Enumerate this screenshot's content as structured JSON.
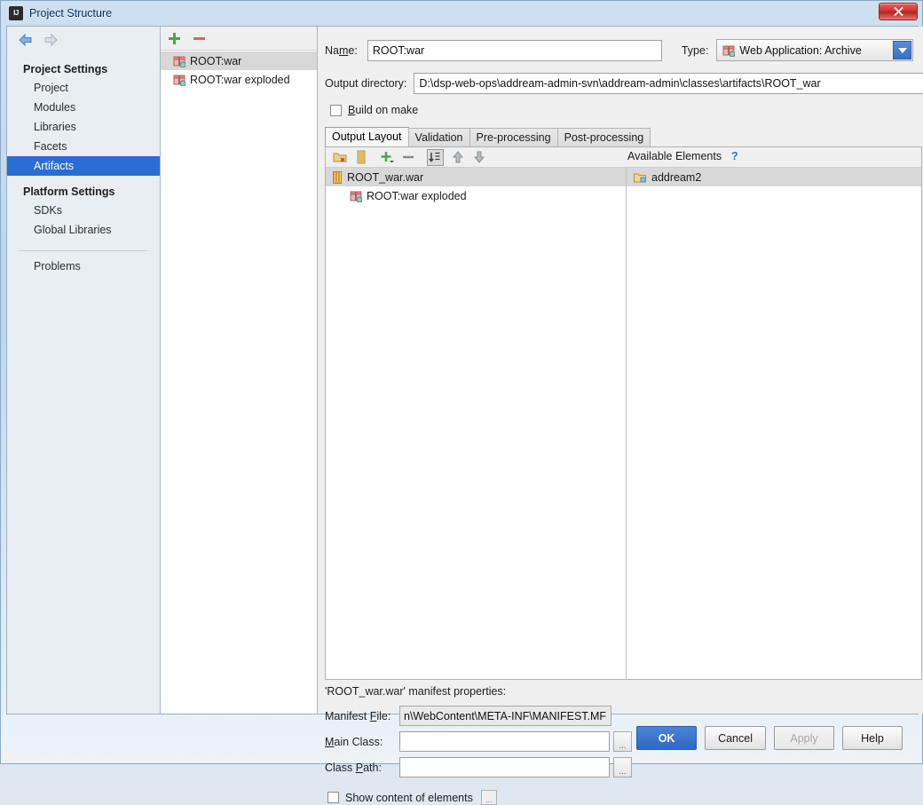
{
  "window": {
    "title": "Project Structure",
    "icon": "intellij-logo-icon",
    "close_label": "×"
  },
  "sidebar": {
    "back_icon": "arrow-left-icon",
    "forward_icon": "arrow-right-icon",
    "groups": [
      {
        "label": "Project Settings",
        "items": [
          {
            "label": "Project",
            "selected": false
          },
          {
            "label": "Modules",
            "selected": false
          },
          {
            "label": "Libraries",
            "selected": false
          },
          {
            "label": "Facets",
            "selected": false
          },
          {
            "label": "Artifacts",
            "selected": true
          }
        ]
      },
      {
        "label": "Platform Settings",
        "items": [
          {
            "label": "SDKs",
            "selected": false
          },
          {
            "label": "Global Libraries",
            "selected": false
          }
        ]
      }
    ],
    "problems_label": "Problems"
  },
  "artifact_list": {
    "add_label": "+",
    "remove_label": "−",
    "items": [
      {
        "label": "ROOT:war",
        "selected": true
      },
      {
        "label": "ROOT:war exploded",
        "selected": false
      }
    ]
  },
  "main": {
    "name_label": "Name:",
    "name_value": "ROOT:war",
    "name_placeholder": "",
    "type_label": "Type:",
    "type_value": "Web Application: Archive",
    "output_dir_label": "Output directory:",
    "output_dir_value": "D:\\dsp-web-ops\\addream-admin-svn\\addream-admin\\classes\\artifacts\\ROOT_war",
    "output_dir_placeholder": "",
    "browse_label": "...",
    "build_on_make_label": "Build on make",
    "build_on_make_checked": false,
    "tabs": [
      {
        "label": "Output Layout",
        "active": true
      },
      {
        "label": "Validation",
        "active": false
      },
      {
        "label": "Pre-processing",
        "active": false
      },
      {
        "label": "Post-processing",
        "active": false
      }
    ],
    "toolbar_icons": [
      "create-directory-icon",
      "create-archive-icon",
      "add-copy-icon",
      "remove-icon",
      "sort-icon",
      "move-up-icon",
      "move-down-icon"
    ],
    "available_elements_label": "Available Elements",
    "help_label": "?",
    "output_tree": [
      {
        "label": "ROOT_war.war",
        "icon": "jar-icon",
        "level": 1,
        "selected": true
      },
      {
        "label": "ROOT:war exploded",
        "icon": "war-icon",
        "level": 2,
        "selected": false
      }
    ],
    "available_tree": [
      {
        "label": "addream2",
        "icon": "folder-icon",
        "level": 1,
        "selected": true
      }
    ],
    "manifest": {
      "title": "'ROOT_war.war' manifest properties:",
      "manifest_file_label": "Manifest File:",
      "manifest_file_value": "n\\WebContent\\META-INF\\MANIFEST.MF",
      "main_class_label": "Main Class:",
      "main_class_value": "",
      "class_path_label": "Class Path:",
      "class_path_value": "",
      "browse_label": "..."
    },
    "show_content_label": "Show content of elements",
    "show_content_checked": false,
    "show_content_dots": "..."
  },
  "footer": {
    "ok_label": "OK",
    "cancel_label": "Cancel",
    "apply_label": "Apply",
    "help_label": "Help"
  },
  "colors": {
    "accent": "#2a6ed4",
    "primary_button": "#2f68c6",
    "selection": "#d8d8d8",
    "close_button": "#d0332e"
  }
}
